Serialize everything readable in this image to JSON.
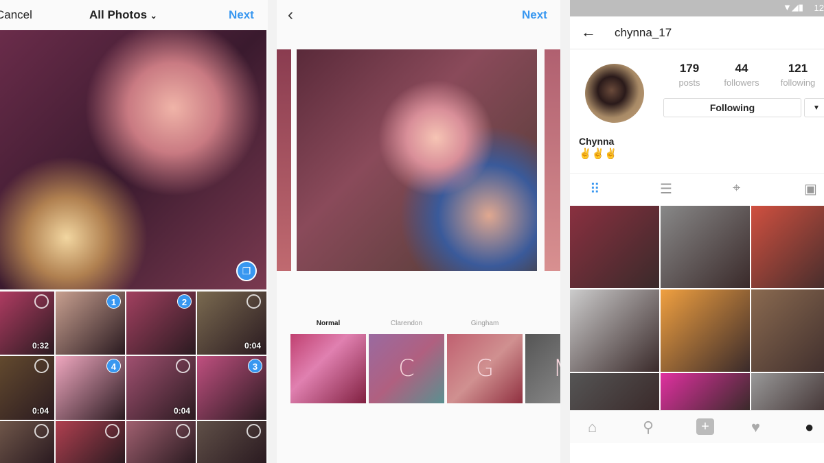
{
  "picker": {
    "cancel_label": "Cancel",
    "album_label": "All Photos",
    "album_icon": "chevron-down-icon",
    "next_label": "Next",
    "multi_select_icon": "multi-select-icon",
    "thumbnails": [
      {
        "duration": "0:32",
        "selection": null
      },
      {
        "duration": null,
        "selection": "1"
      },
      {
        "duration": null,
        "selection": "2"
      },
      {
        "duration": "0:04",
        "selection": null
      },
      {
        "duration": "0:04",
        "selection": null
      },
      {
        "duration": null,
        "selection": "4"
      },
      {
        "duration": "0:04",
        "selection": null
      },
      {
        "duration": null,
        "selection": "3"
      },
      {
        "duration": null,
        "selection": null
      },
      {
        "duration": null,
        "selection": null
      },
      {
        "duration": null,
        "selection": null
      },
      {
        "duration": null,
        "selection": null
      }
    ]
  },
  "editor": {
    "back_icon": "chevron-left-icon",
    "next_label": "Next",
    "filters": [
      {
        "label": "Normal",
        "letter": "",
        "active": true
      },
      {
        "label": "Clarendon",
        "letter": "C",
        "active": false
      },
      {
        "label": "Gingham",
        "letter": "G",
        "active": false
      },
      {
        "label": "M",
        "letter": "M",
        "active": false
      }
    ]
  },
  "profile": {
    "status_time": "12",
    "username": "chynna_17",
    "stats": [
      {
        "value": "179",
        "label": "posts"
      },
      {
        "value": "44",
        "label": "followers"
      },
      {
        "value": "121",
        "label": "following"
      }
    ],
    "following_button": "Following",
    "name": "Chynna",
    "bio": "✌✌✌",
    "tabs": [
      "grid-icon",
      "list-icon",
      "location-icon",
      "tagged-icon"
    ],
    "nav": [
      "home-icon",
      "search-icon",
      "add-icon",
      "heart-icon",
      "profile-icon"
    ],
    "accent": "#3897f0"
  }
}
